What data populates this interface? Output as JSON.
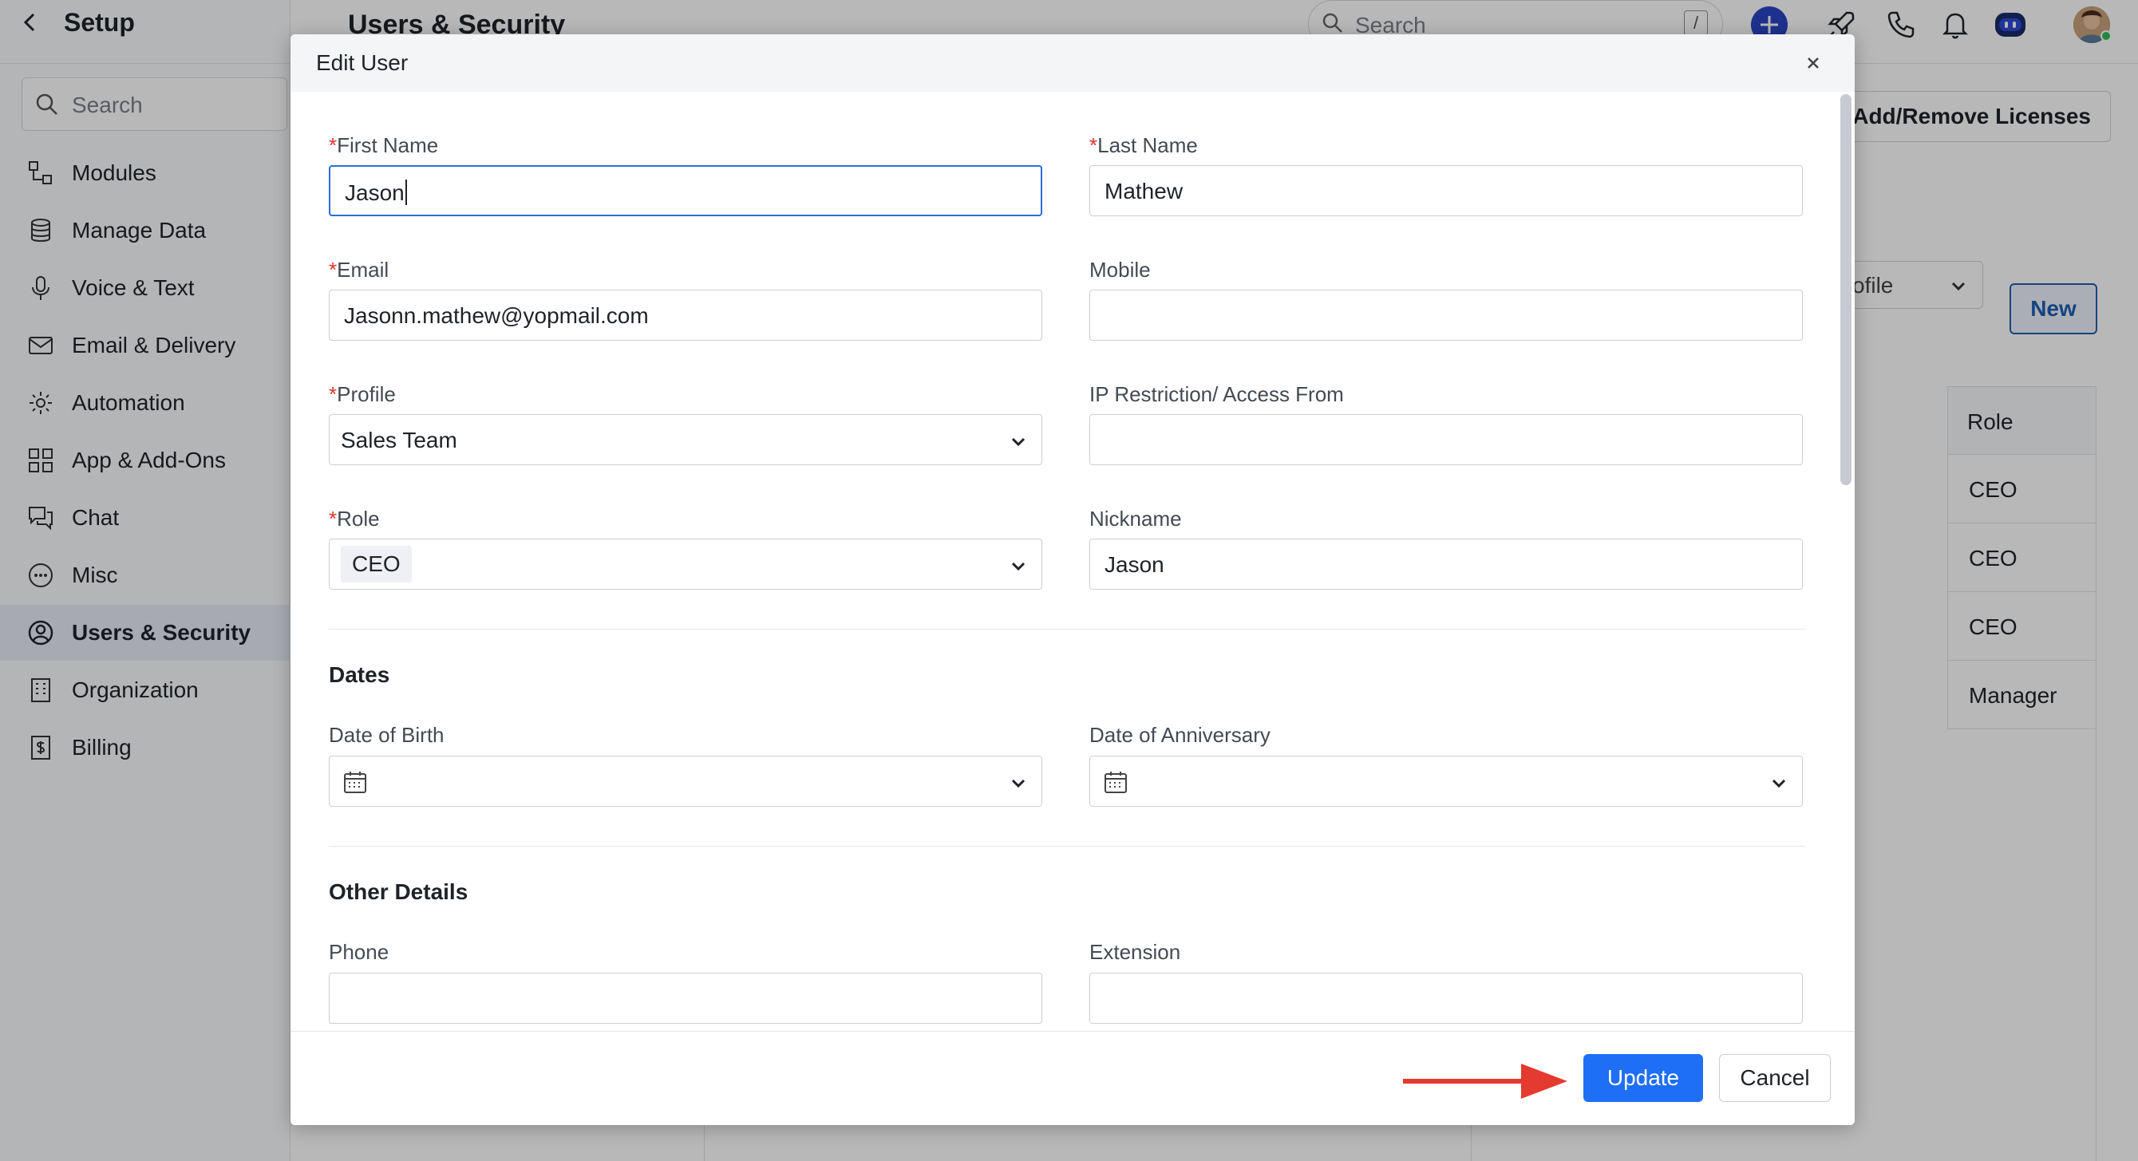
{
  "sidebar": {
    "title": "Setup",
    "search_placeholder": "Search",
    "items": [
      {
        "label": "Modules",
        "icon": "modules-icon"
      },
      {
        "label": "Manage Data",
        "icon": "database-icon"
      },
      {
        "label": "Voice & Text",
        "icon": "microphone-icon"
      },
      {
        "label": "Email & Delivery",
        "icon": "mail-icon"
      },
      {
        "label": "Automation",
        "icon": "automation-icon"
      },
      {
        "label": "App & Add-Ons",
        "icon": "apps-grid-icon"
      },
      {
        "label": "Chat",
        "icon": "chat-icon"
      },
      {
        "label": "Misc",
        "icon": "more-circle-icon"
      },
      {
        "label": "Users & Security",
        "icon": "user-circle-icon",
        "active": true
      },
      {
        "label": "Organization",
        "icon": "building-icon"
      },
      {
        "label": "Billing",
        "icon": "invoice-icon"
      }
    ]
  },
  "topbar": {
    "page_title": "Users & Security",
    "search_placeholder": "Search",
    "search_shortcut": "/",
    "icons": [
      "plus-icon",
      "rocket-icon",
      "phone-icon",
      "bell-icon",
      "bot-icon",
      "avatar"
    ]
  },
  "content": {
    "licenses_button": "Add/Remove Licenses",
    "profile_select_value": "ofile",
    "new_button": "New",
    "table": {
      "header": "Role",
      "rows": [
        "CEO",
        "CEO",
        "CEO",
        "Manager"
      ]
    }
  },
  "modal": {
    "title": "Edit User",
    "required_mark": "*",
    "fields": {
      "first_name": {
        "label": "First Name",
        "value": "Jason"
      },
      "last_name": {
        "label": "Last Name",
        "value": "Mathew"
      },
      "email": {
        "label": "Email",
        "value": "Jasonn.mathew@yopmail.com"
      },
      "mobile": {
        "label": "Mobile",
        "value": ""
      },
      "profile": {
        "label": "Profile",
        "value": "Sales Team"
      },
      "ip_restriction": {
        "label": "IP Restriction/ Access From",
        "value": ""
      },
      "role": {
        "label": "Role",
        "value": "CEO"
      },
      "nickname": {
        "label": "Nickname",
        "value": "Jason"
      },
      "date_of_birth": {
        "label": "Date of Birth",
        "value": ""
      },
      "date_of_anniversary": {
        "label": "Date of Anniversary",
        "value": ""
      },
      "phone": {
        "label": "Phone",
        "value": ""
      },
      "extension": {
        "label": "Extension",
        "value": ""
      }
    },
    "sections": {
      "dates": "Dates",
      "other_details": "Other Details"
    },
    "buttons": {
      "update": "Update",
      "cancel": "Cancel"
    }
  },
  "colors": {
    "primary": "#1e6ff5",
    "required": "#d9352b",
    "annotation_arrow": "#e53a2f"
  }
}
